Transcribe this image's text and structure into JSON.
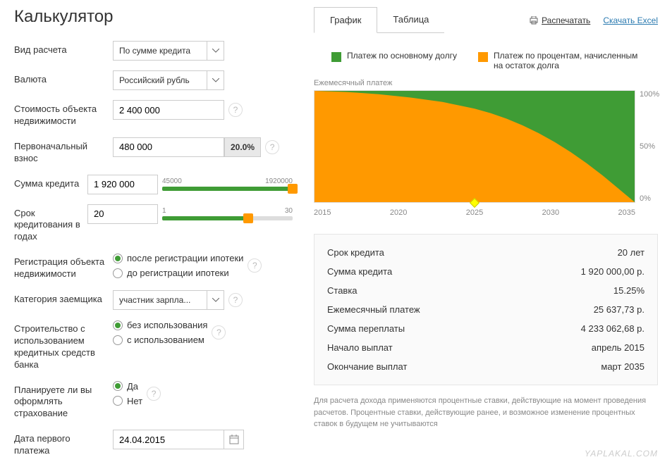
{
  "title": "Калькулятор",
  "form": {
    "calc_type": {
      "label": "Вид расчета",
      "value": "По сумме кредита"
    },
    "currency": {
      "label": "Валюта",
      "value": "Российский рубль"
    },
    "property_cost": {
      "label": "Стоимость объекта недвижимости",
      "value": "2 400 000"
    },
    "initial_payment": {
      "label": "Первоначальный взнос",
      "value": "480 000",
      "pct": "20.0%"
    },
    "loan_amount": {
      "label": "Сумма кредита",
      "value": "1 920 000",
      "min": "45000",
      "max": "1920000"
    },
    "loan_term": {
      "label": "Срок кредитования в годах",
      "value": "20",
      "min": "1",
      "max": "30"
    },
    "registration": {
      "label": "Регистрация объекта недвижимости",
      "opt1": "после регистрации ипотеки",
      "opt2": "до регистрации ипотеки"
    },
    "borrower_cat": {
      "label": "Категория заемщика",
      "value": "участник зарпла..."
    },
    "construction": {
      "label": "Строительство с использованием кредитных средств банка",
      "opt1": "без использования",
      "opt2": "с использованием"
    },
    "insurance": {
      "label": "Планируете ли вы оформлять страхование",
      "opt1": "Да",
      "opt2": "Нет"
    },
    "first_payment_date": {
      "label": "Дата первого платежа",
      "value": "24.04.2015"
    }
  },
  "tabs": {
    "t1": "График",
    "t2": "Таблица"
  },
  "links": {
    "print": "Распечатать",
    "excel": "Скачать Excel"
  },
  "legend": {
    "l1": "Платеж по основному долгу",
    "l2": "Платеж по процентам, начисленным на остаток долга"
  },
  "chart_data": {
    "type": "area",
    "title": "Ежемесячный платеж",
    "x": [
      2015,
      2020,
      2025,
      2030,
      2035
    ],
    "ylim": [
      0,
      100
    ],
    "ylabel_suffix": "%",
    "y_ticks": [
      "100%",
      "50%",
      "0%"
    ],
    "series": [
      {
        "name": "Платеж по процентам, начисленным на остаток долга",
        "color": "#f90",
        "values_at_x": [
          100,
          90,
          75,
          45,
          0
        ]
      },
      {
        "name": "Платеж по основному долгу",
        "color": "#3f9c35",
        "values_at_x": [
          0,
          10,
          25,
          55,
          100
        ]
      }
    ]
  },
  "summary": {
    "r1": {
      "k": "Срок кредита",
      "v": "20 лет"
    },
    "r2": {
      "k": "Сумма кредита",
      "v": "1 920 000,00 р."
    },
    "r3": {
      "k": "Ставка",
      "v": "15.25%"
    },
    "r4": {
      "k": "Ежемесячный платеж",
      "v": "25 637,73 р."
    },
    "r5": {
      "k": "Сумма переплаты",
      "v": "4 233 062,68 р."
    },
    "r6": {
      "k": "Начало выплат",
      "v": "апрель 2015"
    },
    "r7": {
      "k": "Окончание выплат",
      "v": "март 2035"
    }
  },
  "disclaimer": "Для расчета дохода применяются процентные ставки, действующие на момент проведения расчетов. Процентные ставки, действующие ранее, и возможное изменение процентных ставок в будущем не учитываются",
  "watermark": "YAPLAKAL.COM"
}
